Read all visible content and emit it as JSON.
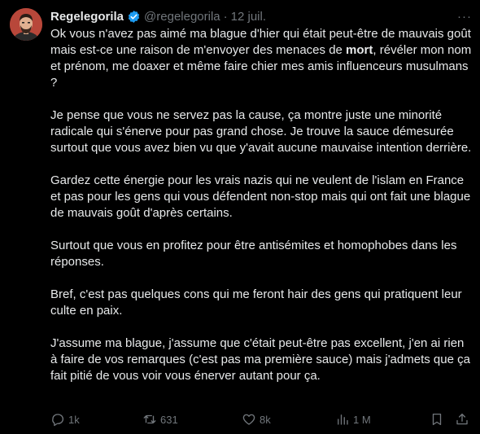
{
  "tweet": {
    "author_name": "Regelegorila",
    "author_handle": "@regelegorila",
    "separator": "·",
    "date": "12 juil.",
    "more_label": "···",
    "paragraphs": [
      {
        "before": "Ok vous n'avez pas aimé ma blague d'hier qui était peut-être de mauvais goût mais est-ce une raison de m'envoyer des menaces de ",
        "bold": "mort",
        "after": ", révéler mon nom et prénom, me doaxer et même faire chier mes amis influenceurs musulmans ?"
      },
      {
        "text": "Je pense que vous ne servez pas la cause, ça montre juste une minorité radicale qui s'énerve pour pas grand chose. Je trouve la sauce démesurée surtout que vous avez bien vu que y'avait aucune mauvaise intention derrière."
      },
      {
        "text": "Gardez cette énergie pour les vrais nazis qui ne veulent de l'islam en France et pas pour les gens qui vous défendent non-stop mais qui ont fait une blague de mauvais goût d'après certains."
      },
      {
        "text": "Surtout que vous en profitez pour être antisémites et homophobes dans les réponses."
      },
      {
        "text": "Bref, c'est pas quelques cons qui me feront hair des gens qui pratiquent leur culte en paix."
      },
      {
        "text": "J'assume ma blague, j'assume que c'était peut-être pas excellent, j'en ai rien à faire de vos remarques (c'est pas ma première sauce) mais j'admets que ça fait pitié de vous voir vous énerver autant pour ça."
      }
    ]
  },
  "actions": {
    "replies": "1k",
    "reposts": "631",
    "likes": "8k",
    "views": "1 M"
  },
  "icons": {
    "verified": "verified-badge-icon",
    "more": "more-options-icon",
    "reply": "reply-icon",
    "repost": "repost-icon",
    "like": "like-icon",
    "views": "views-icon",
    "bookmark": "bookmark-icon",
    "share": "share-icon"
  },
  "colors": {
    "background": "#000000",
    "text": "#e7e9ea",
    "muted": "#71767b",
    "verified": "#1d9bf0"
  }
}
